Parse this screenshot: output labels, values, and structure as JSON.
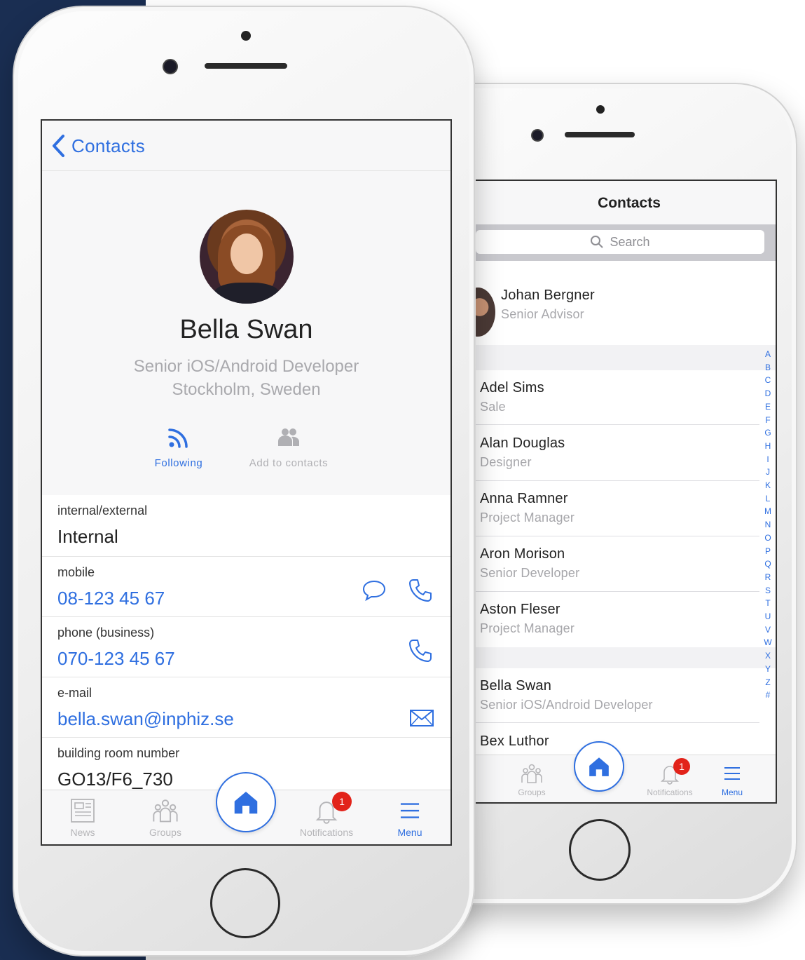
{
  "profile_screen": {
    "back_label": "Contacts",
    "name": "Bella Swan",
    "title": "Senior iOS/Android Developer",
    "location": "Stockholm, Sweden",
    "actions": [
      {
        "label": "Following",
        "icon": "rss-icon",
        "active": true
      },
      {
        "label": "Add to contacts",
        "icon": "people-icon",
        "active": false
      }
    ],
    "fields": [
      {
        "key": "internal/external",
        "value": "Internal"
      },
      {
        "key": "mobile",
        "value": "08-123 45 67"
      },
      {
        "key": "phone (business)",
        "value": "070-123 45 67"
      },
      {
        "key": "e-mail",
        "value": "bella.swan@inphiz.se"
      },
      {
        "key": "building room number",
        "value": "GO13/F6_730"
      }
    ],
    "tabs": [
      {
        "label": "News"
      },
      {
        "label": "Groups"
      },
      {
        "label": "Notifications",
        "badge": "1"
      },
      {
        "label": "Menu",
        "active": true
      }
    ]
  },
  "contacts_screen": {
    "title": "Contacts",
    "search_placeholder": "Search",
    "featured": {
      "name": "Johan Bergner",
      "title": "Senior Advisor"
    },
    "contacts": [
      {
        "name": "Adel Sims",
        "title": "Sale"
      },
      {
        "name": "Alan Douglas",
        "title": "Designer"
      },
      {
        "name": "Anna Ramner",
        "title": "Project Manager"
      },
      {
        "name": "Aron Morison",
        "title": "Senior Developer"
      },
      {
        "name": "Aston Fleser",
        "title": "Project Manager"
      },
      {
        "name": "Bella Swan",
        "title": "Senior iOS/Android Developer"
      },
      {
        "name": "Bex Luthor",
        "title": ""
      }
    ],
    "index_letters": [
      "A",
      "B",
      "C",
      "D",
      "E",
      "F",
      "G",
      "H",
      "I",
      "J",
      "K",
      "L",
      "M",
      "N",
      "O",
      "P",
      "Q",
      "R",
      "S",
      "T",
      "U",
      "V",
      "W",
      "X",
      "Y",
      "Z",
      "#"
    ],
    "tabs": [
      {
        "label": "Groups"
      },
      {
        "label": "Notifications",
        "badge": "1"
      },
      {
        "label": "Menu",
        "active": true
      }
    ]
  },
  "colors": {
    "accent": "#2f6fe0",
    "badge": "#e2231a",
    "navy_background": "#1a2e52"
  }
}
